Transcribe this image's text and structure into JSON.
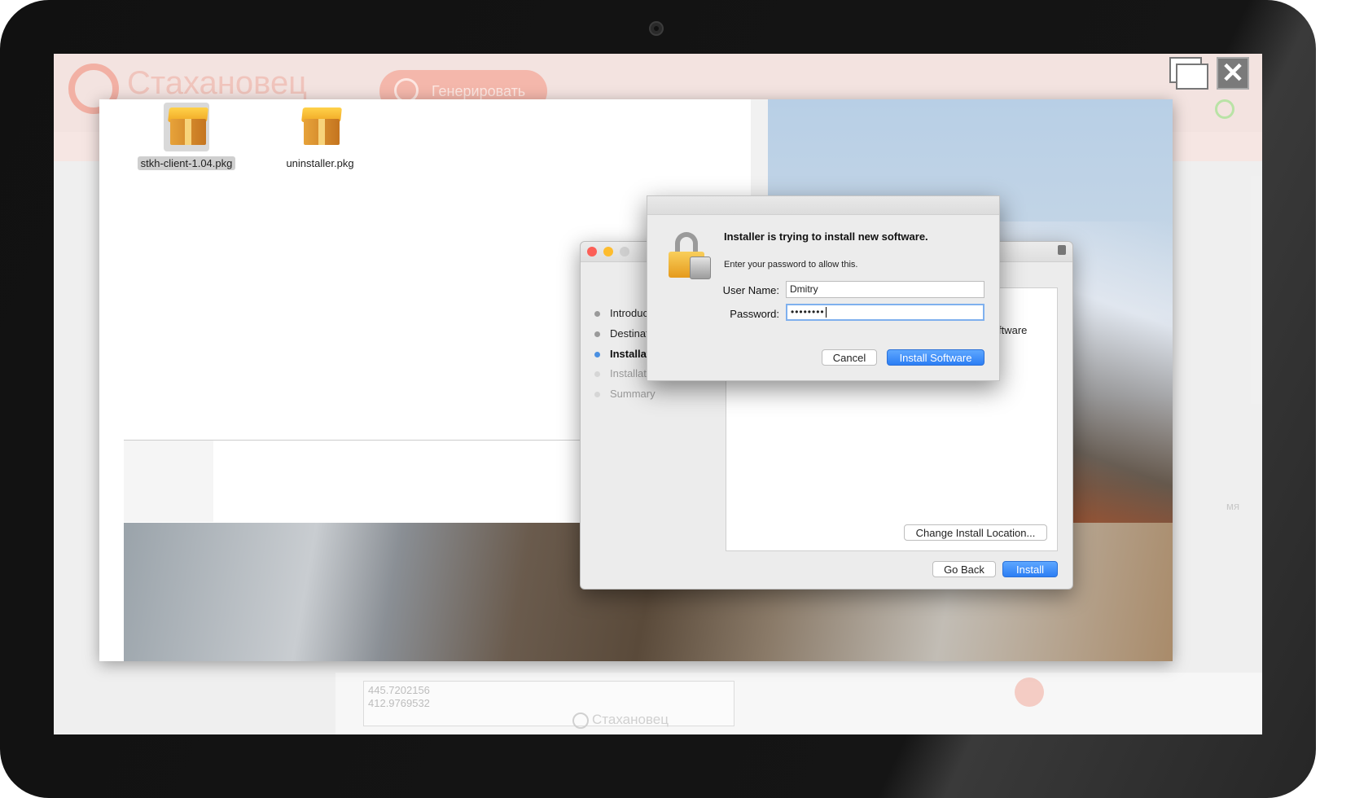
{
  "background_app": {
    "brand": "Стахановец",
    "generate_button_label": "Генерировать",
    "coord_values": [
      "445.7202156",
      "412.9769532"
    ],
    "side_text": "мя"
  },
  "finder": {
    "files": [
      {
        "name": "stkh-client-1.04.pkg",
        "selected": true
      },
      {
        "name": "uninstaller.pkg",
        "selected": false
      }
    ]
  },
  "installer": {
    "steps": [
      {
        "label": "Introduc",
        "state": "done"
      },
      {
        "label": "Destinat",
        "state": "done"
      },
      {
        "label": "Installat",
        "state": "current"
      },
      {
        "label": "Installati",
        "state": "pending"
      },
      {
        "label": "Summary",
        "state": "pending"
      }
    ],
    "content_partial_text": "ftware",
    "change_location_label": "Change Install Location...",
    "go_back_label": "Go Back",
    "install_label": "Install"
  },
  "auth_dialog": {
    "title": "Installer is trying to install new software.",
    "subtitle": "Enter your password to allow this.",
    "username_label": "User Name:",
    "username_value": "Dmitry",
    "password_label": "Password:",
    "password_value": "••••••••",
    "cancel_label": "Cancel",
    "install_software_label": "Install Software"
  },
  "monitor_brand": "Стахановец",
  "colors": {
    "accent_blue": "#2c7ef4",
    "brand_red": "#f2b0a4",
    "traffic_red": "#fc5f57",
    "traffic_yellow": "#fdbc2e"
  }
}
